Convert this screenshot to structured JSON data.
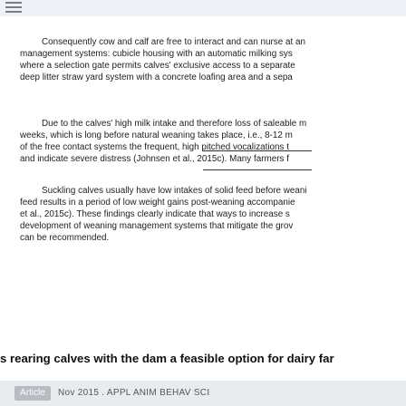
{
  "paragraph1": {
    "lines": [
      "Consequently cow and calf are free to interact and can nurse at an",
      "management systems: cubicle housing with an automatic milking sys",
      "where a selection gate permits calves' exclusive access to a separate",
      "deep litter straw yard system with a concrete loafing area and a sepa"
    ]
  },
  "paragraph2": {
    "lines": [
      "Due to the calves' high milk intake and therefore loss of saleable m",
      "weeks, which is long before natural weaning takes place, i.e., 8-12 m",
      "of the free contact systems the frequent, high pitched vocalizations t",
      "and indicate severe distress (Johnsen et al., 2015c). Many farmers f"
    ]
  },
  "paragraph3": {
    "lines": [
      "Suckling calves usually have low intakes of solid feed before weani",
      "feed results in a period of low weight gains post-weaning accompanie",
      "et al., 2015c). These findings clearly indicate that ways to increase s",
      "development of weaning management systems that mitigate the grov",
      "can be recommended."
    ]
  },
  "title": "s rearing calves with the dam a feasible option for dairy far",
  "footer": {
    "badge": "Article",
    "journal": "Nov 2015 . APPL ANIM BEHAV SCI"
  }
}
